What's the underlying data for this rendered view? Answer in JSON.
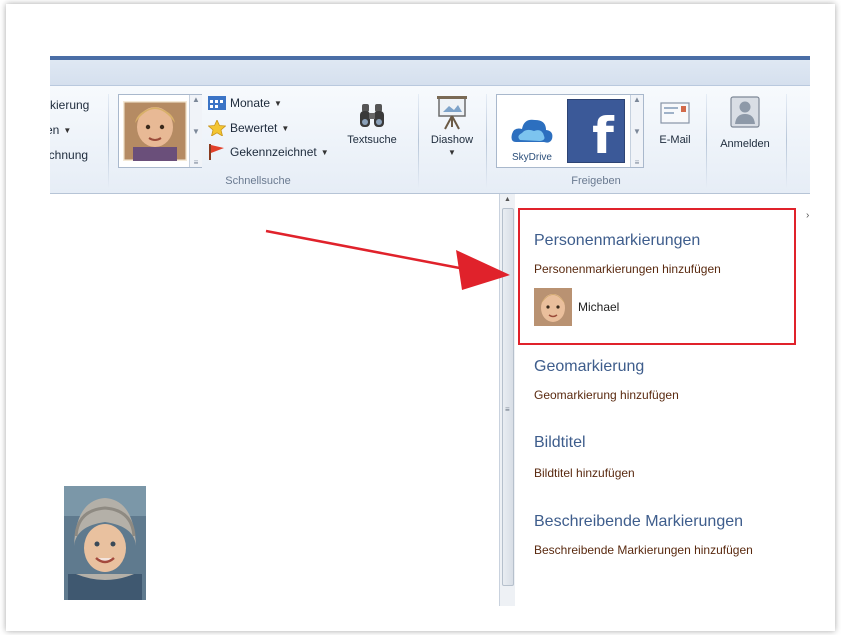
{
  "ribbon": {
    "left_partial_items": [
      "rkierung",
      "en",
      "ichnung"
    ],
    "schnellsuche": {
      "group_label": "Schnellsuche",
      "items": [
        {
          "label": "Monate",
          "icon": "calendar-icon"
        },
        {
          "label": "Bewertet",
          "icon": "star-icon"
        },
        {
          "label": "Gekennzeichnet",
          "icon": "flag-icon"
        }
      ],
      "textsuche_label": "Textsuche"
    },
    "diashow_label": "Diashow",
    "freigeben": {
      "group_label": "Freigeben",
      "skydrive_label": "SkyDrive",
      "email_label": "E-Mail"
    },
    "anmelden_label": "Anmelden"
  },
  "info_pane": {
    "sections": [
      {
        "title": "Personenmarkierungen",
        "link": "Personenmarkierungen hinzufügen",
        "person": "Michael"
      },
      {
        "title": "Geomarkierung",
        "link": "Geomarkierung hinzufügen"
      },
      {
        "title": "Bildtitel",
        "link": "Bildtitel hinzufügen"
      },
      {
        "title": "Beschreibende Markierungen",
        "link": "Beschreibende Markierungen hinzufügen"
      }
    ]
  },
  "colors": {
    "annotation_red": "#e0222b",
    "section_title": "#3e5d8c",
    "link_text": "#5a2a10"
  }
}
